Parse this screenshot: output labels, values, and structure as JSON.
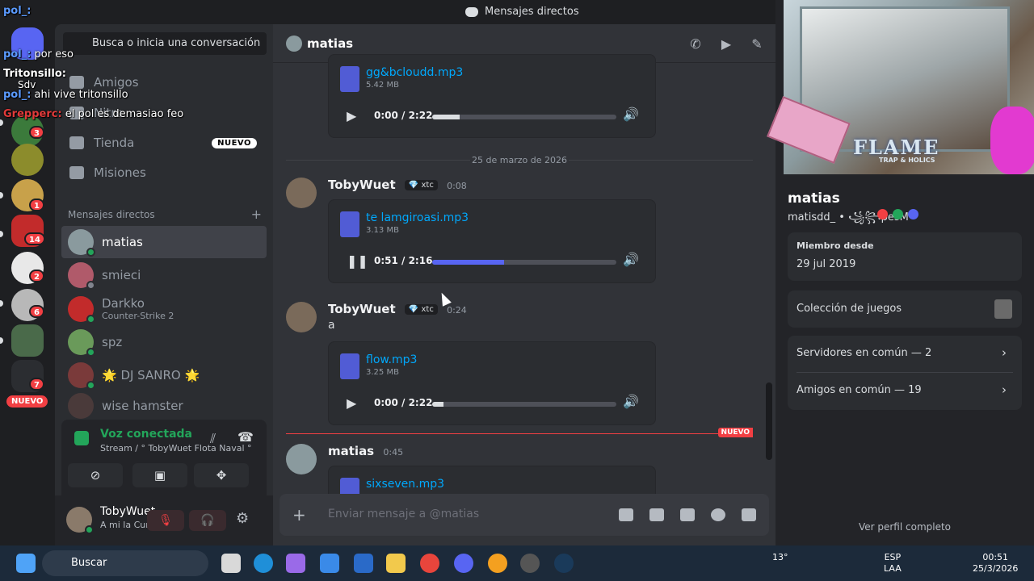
{
  "window_title": "Mensajes directos",
  "overlay_chat": [
    {
      "user": "pol_:",
      "text": ""
    },
    {
      "user": "pol_:",
      "text": ""
    },
    {
      "user": "pol_:",
      "text": "por eso"
    },
    {
      "user": "Tritonsillo:",
      "text": ""
    },
    {
      "user": "Sdv",
      "text": ""
    },
    {
      "user": "pol_:",
      "text": "ahi vive tritonsillo"
    },
    {
      "user": "Grepperc:",
      "text": "el pol es demasiao feo"
    }
  ],
  "servers": [
    {
      "name": "discord-home",
      "color": "#5865f2",
      "badge": ""
    },
    {
      "name": "server-a",
      "color": "#3b7a3b",
      "badge": "3"
    },
    {
      "name": "server-b",
      "color": "#8c8c2c",
      "badge": ""
    },
    {
      "name": "server-c",
      "color": "#c8a14a",
      "badge": "1"
    },
    {
      "name": "server-d",
      "color": "#c22b2b",
      "badge": "14"
    },
    {
      "name": "server-e",
      "color": "#e8e8e8",
      "badge": "2"
    },
    {
      "name": "server-f",
      "color": "#b8b8b8",
      "badge": "6"
    },
    {
      "name": "server-g",
      "color": "#4a6a4a",
      "badge": ""
    },
    {
      "name": "server-h",
      "color": "#1e1f22",
      "badge": "7"
    }
  ],
  "rail_new_label": "NUEVO",
  "sidebar": {
    "search_placeholder": "Busca o inicia una conversación",
    "nav": [
      {
        "label": "Amigos"
      },
      {
        "label": "Nitro"
      },
      {
        "label": "Tienda",
        "tag": "NUEVO"
      },
      {
        "label": "Misiones"
      }
    ],
    "dm_header": "Mensajes directos",
    "dms": [
      {
        "name": "matias",
        "sub": "",
        "color": "#8a9a9e",
        "status": "#23a55a"
      },
      {
        "name": "smieci",
        "sub": "",
        "color": "#b05a6a",
        "status": "#80848e"
      },
      {
        "name": "Darkko",
        "sub": "Counter-Strike 2",
        "color": "#c22b2b",
        "status": "#23a55a"
      },
      {
        "name": "spz",
        "sub": "",
        "color": "#6a9a5a",
        "status": "#23a55a"
      },
      {
        "name": "🌟 DJ SANRO 🌟",
        "sub": "",
        "color": "#7a3a3a",
        "status": "#23a55a"
      },
      {
        "name": "wise hamster",
        "sub": "",
        "color": "#4a3a3a",
        "status": "#23a55a"
      }
    ]
  },
  "voice": {
    "status": "Voz conectada",
    "detail": "Stream / ° TobyWuet Flota Naval °"
  },
  "user": {
    "name": "TobyWuet",
    "status": "A mi la Cumbia vill"
  },
  "chat": {
    "recipient": "matias",
    "date_separator": "25 de marzo de 2026",
    "new_label": "NUEVO",
    "composer_placeholder": "Enviar mensaje a @matias",
    "attachments": [
      {
        "file": "gg&bcloudd.mp3",
        "size": "5.42 MB",
        "time": "0:00 / 2:22",
        "progress": 0.15,
        "playing": false
      },
      {
        "file": "te lamgiroasi.mp3",
        "size": "3.13 MB",
        "time": "0:51 / 2:16",
        "progress": 0.39,
        "playing": true
      },
      {
        "file": "flow.mp3",
        "size": "3.25 MB",
        "time": "0:00 / 2:22",
        "progress": 0.06,
        "playing": false
      },
      {
        "file": "sixseven.mp3",
        "size": "",
        "time": "",
        "progress": 0,
        "playing": false
      }
    ],
    "messages": [
      {
        "author": "TobyWuet",
        "tag": "xtc",
        "time": "0:08",
        "text": ""
      },
      {
        "author": "TobyWuet",
        "tag": "xtc",
        "time": "0:24",
        "text": "a"
      },
      {
        "author": "matias",
        "tag": "",
        "time": "0:45",
        "text": ""
      }
    ]
  },
  "profile": {
    "banner_text": "FLAME",
    "banner_sub": "TRAP & HOLICS",
    "display_name": "matias",
    "username": "matisdd_ • ꧁꧂pesM",
    "member_since_label": "Miembro desde",
    "member_since": "29 jul 2019",
    "games_label": "Colección de juegos",
    "servers_common": "Servidores en común — 2",
    "friends_common": "Amigos en común — 19",
    "full_profile": "Ver perfil completo"
  },
  "taskbar": {
    "search": "Buscar",
    "weather": "13°",
    "lang": "ESP",
    "layout": "LAA",
    "time": "00:51",
    "date": "25/3/2026"
  }
}
